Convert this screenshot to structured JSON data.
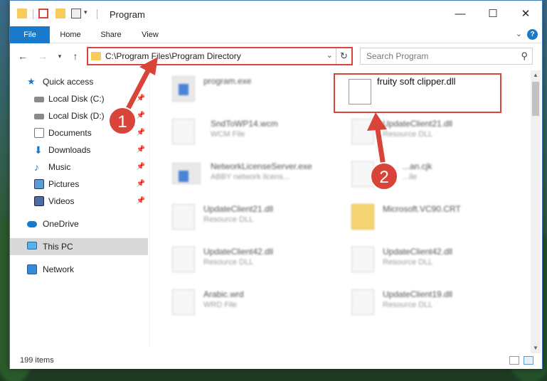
{
  "window": {
    "title": "Program",
    "minimize_icon": "minimize-icon",
    "maximize_icon": "maximize-icon",
    "close_icon": "close-icon"
  },
  "ribbon": {
    "tabs": [
      "File",
      "Home",
      "Share",
      "View"
    ],
    "help": "?"
  },
  "navigation": {
    "address": "C:\\Program Files\\Program Directory",
    "search_placeholder": "Search Program"
  },
  "sidebar": {
    "items": [
      {
        "label": "Quick access",
        "icon": "star-icon",
        "pinned": false
      },
      {
        "label": "Local Disk (C:)",
        "icon": "drive-icon",
        "pinned": true
      },
      {
        "label": "Local Disk (D:)",
        "icon": "drive-icon",
        "pinned": true
      },
      {
        "label": "Documents",
        "icon": "document-icon",
        "pinned": true
      },
      {
        "label": "Downloads",
        "icon": "download-icon",
        "pinned": true
      },
      {
        "label": "Music",
        "icon": "music-icon",
        "pinned": true
      },
      {
        "label": "Pictures",
        "icon": "picture-icon",
        "pinned": true
      },
      {
        "label": "Videos",
        "icon": "video-icon",
        "pinned": true
      },
      {
        "label": "OneDrive",
        "icon": "cloud-icon",
        "pinned": false
      },
      {
        "label": "This PC",
        "icon": "computer-icon",
        "pinned": false,
        "selected": true
      },
      {
        "label": "Network",
        "icon": "network-icon",
        "pinned": false
      }
    ]
  },
  "files": [
    {
      "name": "program.exe",
      "type": "",
      "icon": "exe"
    },
    {
      "name": "fruity soft clipper.dll",
      "type": "",
      "icon": "dll",
      "highlighted": true
    },
    {
      "name": "SndToWP14.wcm",
      "type": "WCM File",
      "icon": "file"
    },
    {
      "name": "UpdateClient21.dll",
      "type": "Resource DLL",
      "icon": "dll"
    },
    {
      "name": "NetworkLicenseServer.exe",
      "type": "ABBY network licens...",
      "icon": "exe"
    },
    {
      "name": "...an.cjk",
      "type": "...ile",
      "icon": "file"
    },
    {
      "name": "UpdateClient21.dll",
      "type": "Resource DLL",
      "icon": "dll"
    },
    {
      "name": "Microsoft.VC90.CRT",
      "type": "",
      "icon": "folder"
    },
    {
      "name": "UpdateClient42.dll",
      "type": "Resource DLL",
      "icon": "dll"
    },
    {
      "name": "UpdateClient42.dll",
      "type": "Resource DLL",
      "icon": "dll"
    },
    {
      "name": "Arabic.wrd",
      "type": "WRD File",
      "icon": "file"
    },
    {
      "name": "UpdateClient19.dll",
      "type": "Resource DLL",
      "icon": "dll"
    }
  ],
  "status": {
    "item_count": "199 items"
  },
  "annotations": {
    "callout_1": "1",
    "callout_2": "2",
    "accent_color": "#d9443a"
  }
}
